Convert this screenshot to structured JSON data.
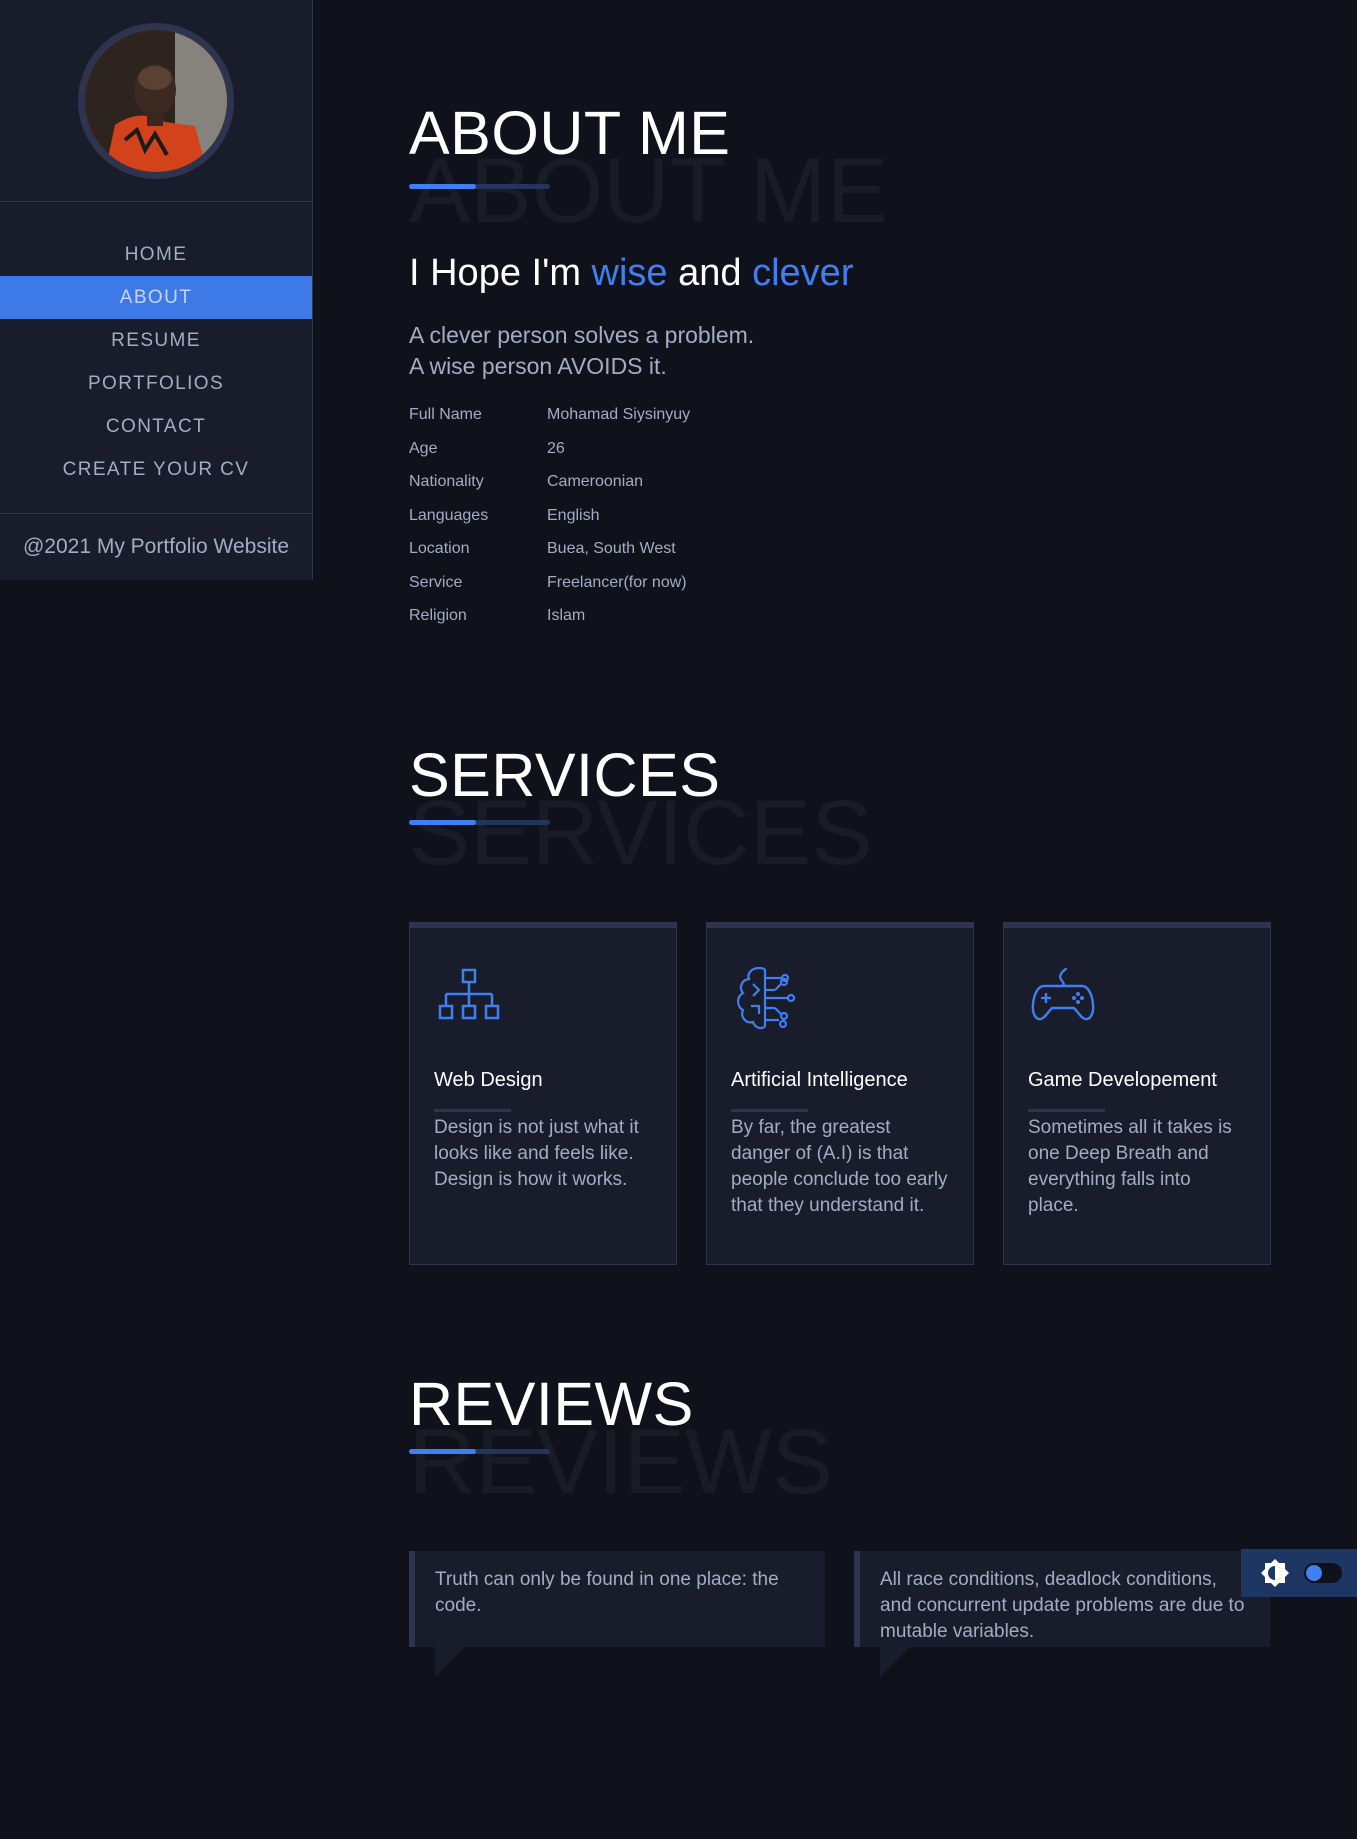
{
  "sidebar": {
    "nav": [
      "HOME",
      "ABOUT",
      "RESUME",
      "PORTFOLIOS",
      "CONTACT",
      "CREATE YOUR CV"
    ],
    "active_index": 1,
    "footer": "@2021 My Portfolio Website"
  },
  "about": {
    "title": "ABOUT ME",
    "ghost": "ABOUT ME",
    "hope_prefix": "I Hope I'm ",
    "hope_word1": "wise",
    "hope_and": " and ",
    "hope_word2": "clever",
    "quote_line1": "A clever person solves a problem.",
    "quote_line2": "A wise person AVOIDS it.",
    "info": [
      {
        "k": "Full Name",
        "v": "Mohamad Siysinyuy"
      },
      {
        "k": "Age",
        "v": "26"
      },
      {
        "k": "Nationality",
        "v": "Cameroonian"
      },
      {
        "k": "Languages",
        "v": "English"
      },
      {
        "k": "Location",
        "v": "Buea, South West"
      },
      {
        "k": "Service",
        "v": "Freelancer(for now)"
      },
      {
        "k": "Religion",
        "v": "Islam"
      }
    ]
  },
  "services": {
    "title": "SERVICES",
    "ghost": "SERVICES",
    "cards": [
      {
        "icon": "sitemap-icon",
        "title": "Web Design",
        "text": "Design is not just what it looks like and feels like. Design is how it works."
      },
      {
        "icon": "brain-circuit-icon",
        "title": "Artificial Intelligence",
        "text": "By far, the greatest danger of (A.I) is that people conclude too early that they understand it."
      },
      {
        "icon": "gamepad-icon",
        "title": "Game Developement",
        "text": "Sometimes all it takes is one Deep Breath and everything falls into place."
      }
    ]
  },
  "reviews": {
    "title": "REVIEWS",
    "ghost": "REVIEWS",
    "items": [
      "Truth can only be found in one place: the code.",
      "All race conditions, deadlock conditions, and concurrent update problems are due to mutable variables."
    ]
  },
  "colors": {
    "accent": "#3f7ff2",
    "background": "#10121b",
    "panel": "#191d2b",
    "border": "#2e344e"
  }
}
